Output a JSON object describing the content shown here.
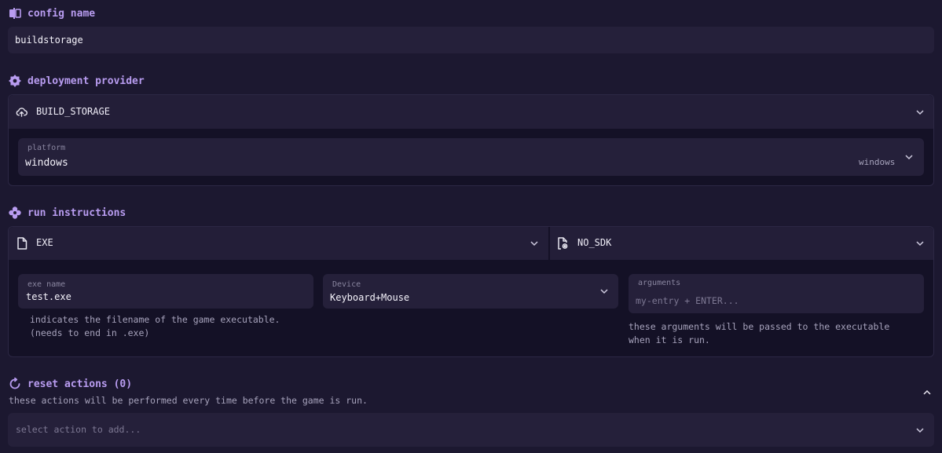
{
  "config_name": {
    "title": "config name",
    "value": "buildstorage"
  },
  "deployment_provider": {
    "title": "deployment provider",
    "provider": "BUILD_STORAGE",
    "platform_label": "platform",
    "platform_value": "windows",
    "platform_selected": "windows"
  },
  "run_instructions": {
    "title": "run instructions",
    "type_value": "EXE",
    "sdk_value": "NO_SDK",
    "exe_name_label": "exe name",
    "exe_name_value": "test.exe",
    "exe_hint_line1": "indicates the filename of the game executable.",
    "exe_hint_line2": "(needs to end in .exe)",
    "device_label": "Device",
    "device_value": "Keyboard+Mouse",
    "arguments_label": "arguments",
    "arguments_placeholder": "my-entry + ENTER...",
    "arguments_hint_line1": "these arguments will be passed to the executable",
    "arguments_hint_line2": "when it is run."
  },
  "reset_actions": {
    "title": "reset actions (0)",
    "description": "these actions will be performed every time before the game is run.",
    "select_placeholder": "select action to add..."
  },
  "colors": {
    "accent": "#b89cf0",
    "background": "#1c1830",
    "field": "#25203a",
    "panel": "#141126"
  }
}
